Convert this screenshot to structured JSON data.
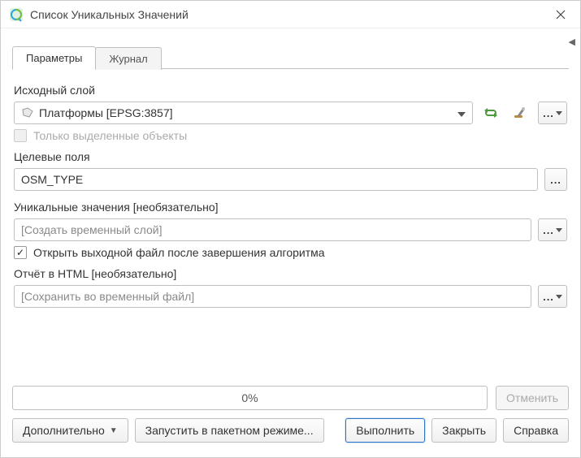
{
  "window": {
    "title": "Список Уникальных Значений"
  },
  "tabs": {
    "parameters": "Параметры",
    "log": "Журнал"
  },
  "params": {
    "input_layer_label": "Исходный слой",
    "input_layer_value": "Платформы [EPSG:3857]",
    "selected_only_label": "Только выделенные объекты",
    "target_fields_label": "Целевые поля",
    "target_fields_value": "OSM_TYPE",
    "unique_values_label": "Уникальные значения [необязательно]",
    "unique_values_placeholder": "[Создать временный слой]",
    "open_after_label": "Открыть выходной файл после завершения алгоритма",
    "open_after_checked": true,
    "html_report_label": "Отчёт в HTML [необязательно]",
    "html_report_placeholder": "[Сохранить во временный файл]"
  },
  "footer": {
    "progress_text": "0%",
    "cancel": "Отменить",
    "advanced": "Дополнительно",
    "batch": "Запустить в пакетном режиме...",
    "run": "Выполнить",
    "close": "Закрыть",
    "help": "Справка"
  }
}
